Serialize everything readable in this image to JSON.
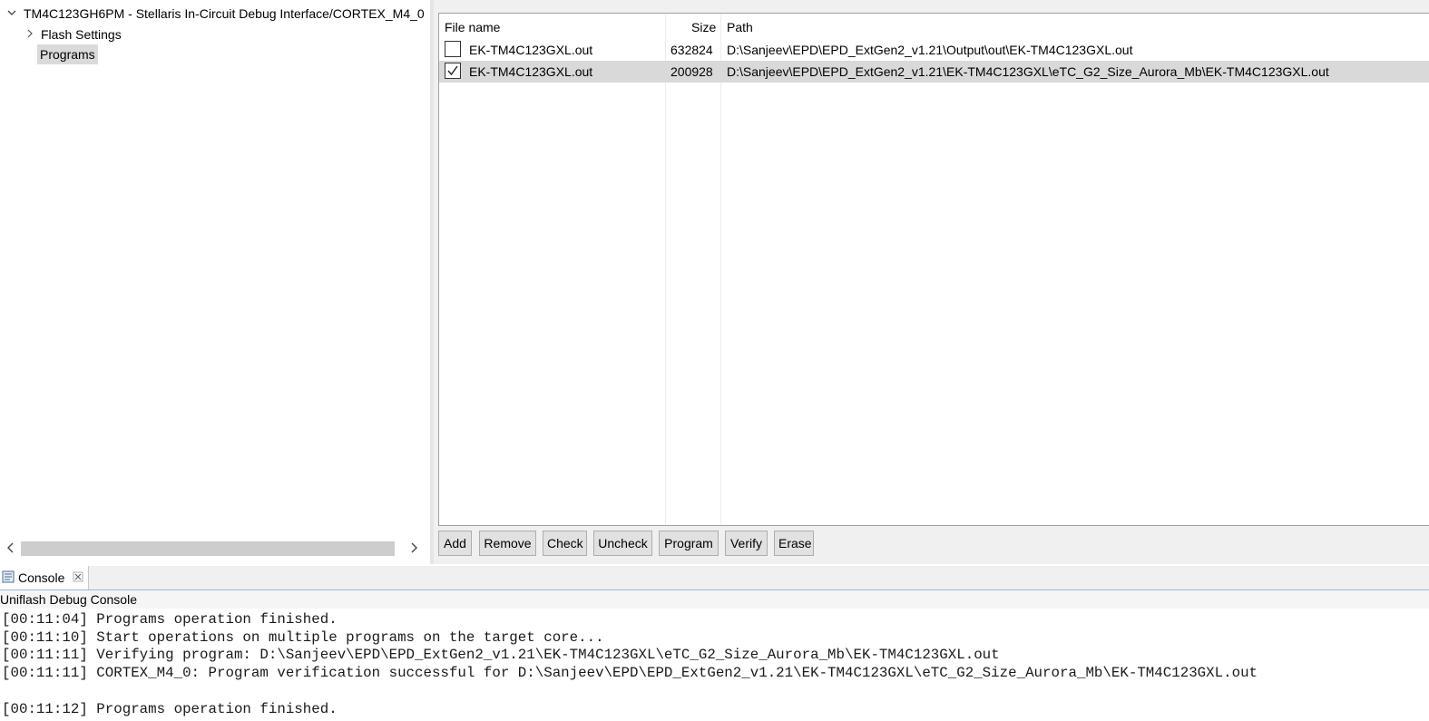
{
  "tree": {
    "root": {
      "label": "TM4C123GH6PM - Stellaris In-Circuit Debug Interface/CORTEX_M4_0",
      "expanded": true
    },
    "children": [
      {
        "label": "Flash Settings",
        "expanded": false
      },
      {
        "label": "Programs",
        "selected": true
      }
    ]
  },
  "programs_table": {
    "columns": [
      "File name",
      "Size",
      "Path"
    ],
    "rows": [
      {
        "checked": false,
        "file_name": "EK-TM4C123GXL.out",
        "size": "632824",
        "path": "D:\\Sanjeev\\EPD\\EPD_ExtGen2_v1.21\\Output\\out\\EK-TM4C123GXL.out"
      },
      {
        "checked": true,
        "file_name": "EK-TM4C123GXL.out",
        "size": "200928",
        "path": "D:\\Sanjeev\\EPD\\EPD_ExtGen2_v1.21\\EK-TM4C123GXL\\eTC_G2_Size_Aurora_Mb\\EK-TM4C123GXL.out"
      }
    ]
  },
  "buttons": [
    "Add",
    "Remove",
    "Check",
    "Uncheck",
    "Program",
    "Verify",
    "Erase"
  ],
  "console": {
    "tab_label": "Console",
    "title": "Uniflash Debug Console",
    "lines": [
      "[00:11:04] Programs operation finished.",
      "[00:11:10] Start operations on multiple programs on the target core...",
      "[00:11:11] Verifying program: D:\\Sanjeev\\EPD\\EPD_ExtGen2_v1.21\\EK-TM4C123GXL\\eTC_G2_Size_Aurora_Mb\\EK-TM4C123GXL.out",
      "[00:11:11] CORTEX_M4_0: Program verification successful for D:\\Sanjeev\\EPD\\EPD_ExtGen2_v1.21\\EK-TM4C123GXL\\eTC_G2_Size_Aurora_Mb\\EK-TM4C123GXL.out",
      "",
      "[00:11:12] Programs operation finished."
    ]
  },
  "icons": {
    "expand_open": "chevron-down-icon",
    "expand_closed": "chevron-right-icon",
    "console": "console-icon",
    "close": "close-icon",
    "scroll_left": "scroll-left-icon",
    "scroll_right": "scroll-right-icon",
    "check": "checkmark-icon"
  },
  "colors": {
    "selection": "#d9d9d9",
    "panel_bg": "#f0f0f0",
    "console_tab_underline": "#9cb8d9"
  }
}
